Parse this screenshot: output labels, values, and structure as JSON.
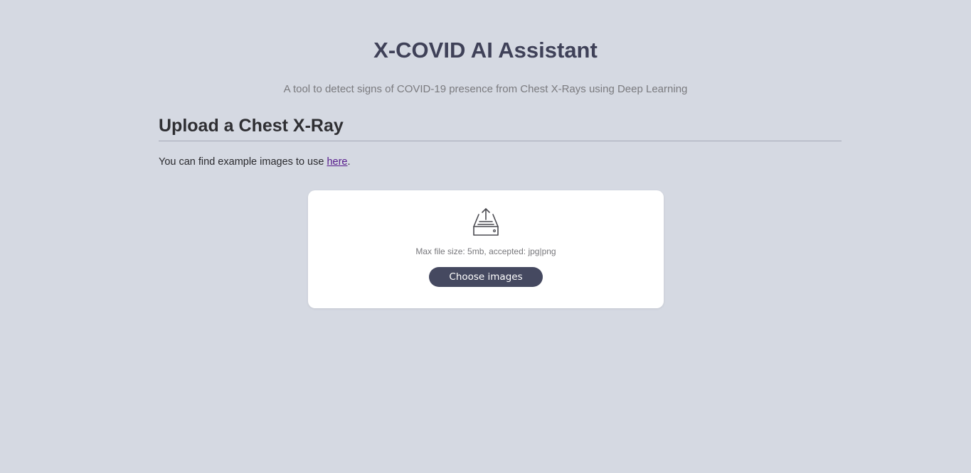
{
  "header": {
    "title": "X-COVID AI Assistant",
    "subtitle": "A tool to detect signs of COVID-19 presence from Chest X-Rays using Deep Learning"
  },
  "upload_section": {
    "title": "Upload a Chest X-Ray",
    "intro_text": "You can find example images to use ",
    "link_label": "here",
    "intro_suffix": "."
  },
  "upload_card": {
    "icon": "upload-tray-icon",
    "hint": "Max file size: 5mb, accepted: jpg|png",
    "button_label": "Choose images"
  },
  "colors": {
    "page_background": "#d5d9e2",
    "title": "#3f4158",
    "button_background": "#454960",
    "link": "#551a8b",
    "card_background": "#ffffff"
  }
}
